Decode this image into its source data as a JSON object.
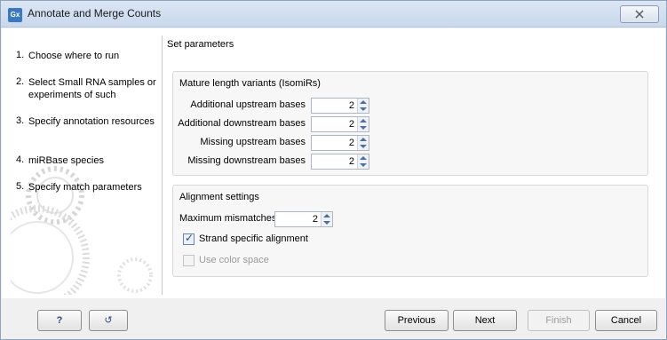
{
  "window": {
    "title": "Annotate and Merge Counts",
    "app_icon": "Gx",
    "close_glyph": "☒"
  },
  "sidebar": {
    "steps": [
      {
        "num": "1.",
        "label": "Choose where to run"
      },
      {
        "num": "2.",
        "label": "Select Small RNA samples or experiments of such"
      },
      {
        "num": "3.",
        "label": "Specify annotation resources"
      },
      {
        "num": "4.",
        "label": "miRBase species"
      },
      {
        "num": "5.",
        "label": "Specify match parameters"
      }
    ],
    "active_step": 5
  },
  "main": {
    "section_title": "Set parameters",
    "isomirs": {
      "title": "Mature length variants (IsomiRs)",
      "fields": [
        {
          "label": "Additional upstream bases",
          "value": "2"
        },
        {
          "label": "Additional downstream bases",
          "value": "2"
        },
        {
          "label": "Missing upstream bases",
          "value": "2"
        },
        {
          "label": "Missing downstream bases",
          "value": "2"
        }
      ]
    },
    "alignment": {
      "title": "Alignment settings",
      "max_mismatches_label": "Maximum mismatches",
      "max_mismatches_value": "2",
      "strand_specific_label": "Strand specific alignment",
      "strand_specific_checked": true,
      "color_space_label": "Use color space",
      "color_space_enabled": false
    }
  },
  "footer": {
    "help_label": "?",
    "reset_icon": "↺",
    "previous_label": "Previous",
    "next_label": "Next",
    "finish_label": "Finish",
    "cancel_label": "Cancel"
  },
  "colors": {
    "accent": "#3a78c3",
    "title_bar": "#c9d8ec"
  }
}
